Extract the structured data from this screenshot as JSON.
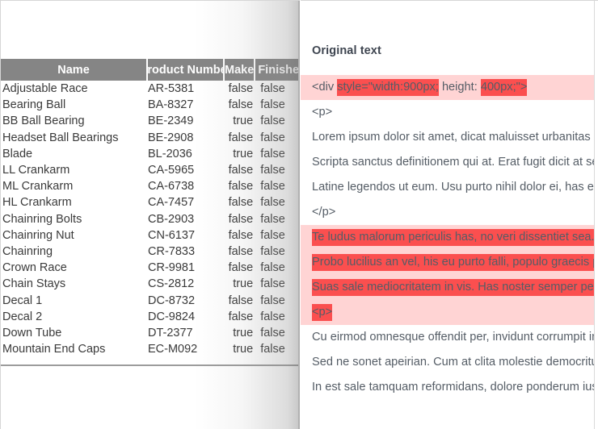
{
  "grid": {
    "columns": [
      "Name",
      "Product Number",
      "Make",
      "Finished"
    ],
    "rows": [
      {
        "name": "Adjustable Race",
        "product_number": "AR-5381",
        "make": "false",
        "finished": "false"
      },
      {
        "name": "Bearing Ball",
        "product_number": "BA-8327",
        "make": "false",
        "finished": "false"
      },
      {
        "name": "BB Ball Bearing",
        "product_number": "BE-2349",
        "make": "true",
        "finished": "false"
      },
      {
        "name": "Headset Ball Bearings",
        "product_number": "BE-2908",
        "make": "false",
        "finished": "false"
      },
      {
        "name": "Blade",
        "product_number": "BL-2036",
        "make": "true",
        "finished": "false"
      },
      {
        "name": "LL Crankarm",
        "product_number": "CA-5965",
        "make": "false",
        "finished": "false"
      },
      {
        "name": "ML Crankarm",
        "product_number": "CA-6738",
        "make": "false",
        "finished": "false"
      },
      {
        "name": "HL Crankarm",
        "product_number": "CA-7457",
        "make": "false",
        "finished": "false"
      },
      {
        "name": "Chainring Bolts",
        "product_number": "CB-2903",
        "make": "false",
        "finished": "false"
      },
      {
        "name": "Chainring Nut",
        "product_number": "CN-6137",
        "make": "false",
        "finished": "false"
      },
      {
        "name": "Chainring",
        "product_number": "CR-7833",
        "make": "false",
        "finished": "false"
      },
      {
        "name": "Crown Race",
        "product_number": "CR-9981",
        "make": "false",
        "finished": "false"
      },
      {
        "name": "Chain Stays",
        "product_number": "CS-2812",
        "make": "true",
        "finished": "false"
      },
      {
        "name": "Decal 1",
        "product_number": "DC-8732",
        "make": "false",
        "finished": "false"
      },
      {
        "name": "Decal 2",
        "product_number": "DC-9824",
        "make": "false",
        "finished": "false"
      },
      {
        "name": "Down Tube",
        "product_number": "DT-2377",
        "make": "true",
        "finished": "false"
      },
      {
        "name": "Mountain End Caps",
        "product_number": "EC-M092",
        "make": "true",
        "finished": "false"
      }
    ]
  },
  "diff": {
    "title": "Original text",
    "lines": [
      {
        "changed": true,
        "segments": [
          {
            "text": "<div ",
            "hl": false
          },
          {
            "text": "style=\"width:900px;",
            "hl": true
          },
          {
            "text": " height: ",
            "hl": false
          },
          {
            "text": "400px;\">",
            "hl": true
          }
        ]
      },
      {
        "changed": false,
        "segments": [
          {
            "text": "<p>",
            "hl": false
          }
        ]
      },
      {
        "changed": false,
        "segments": [
          {
            "text": "Lorem ipsum dolor sit amet, dicat maluisset urbanitas has id,",
            "hl": false
          }
        ]
      },
      {
        "changed": false,
        "segments": [
          {
            "text": "Scripta sanctus definitionem qui at. Erat fugit dicit at sea, ne e",
            "hl": false
          }
        ]
      },
      {
        "changed": false,
        "segments": [
          {
            "text": "Latine legendos ut eum. Usu purto nihil dolor ei, has et iriure",
            "hl": false
          }
        ]
      },
      {
        "changed": false,
        "segments": [
          {
            "text": "</p>",
            "hl": false
          }
        ]
      },
      {
        "changed": true,
        "segments": [
          {
            "text": "Te ludus malorum periculis has, no veri dissentiet sea. <br/>",
            "hl": true
          }
        ]
      },
      {
        "changed": true,
        "segments": [
          {
            "text": "Probo lucilius an vel, his eu purto falli, populo graecis postula",
            "hl": true
          }
        ]
      },
      {
        "changed": true,
        "segments": [
          {
            "text": "Suas sale mediocritatem in vis. Has noster semper perpetua",
            "hl": true
          }
        ]
      },
      {
        "changed": true,
        "segments": [
          {
            "text": "<p>",
            "hl": true
          }
        ]
      },
      {
        "changed": false,
        "segments": [
          {
            "text": "Cu eirmod omnesque offendit per, invidunt corrumpit intelle",
            "hl": false
          }
        ]
      },
      {
        "changed": false,
        "segments": [
          {
            "text": "Sed ne sonet apeirian. Cum at clita molestie democritum, dia",
            "hl": false
          }
        ]
      },
      {
        "changed": false,
        "segments": [
          {
            "text": "In est sale tamquam reformidans, dolore ponderum ius et. T",
            "hl": false
          }
        ]
      }
    ],
    "scrollbar": "horizontal-scrollbar-thumb",
    "cursor": "mouse-pointer"
  },
  "colors": {
    "header_bg": "#858585",
    "diff_block": "#ffd4d4",
    "diff_inline": "#fb4f4f",
    "text": "#555d66"
  }
}
